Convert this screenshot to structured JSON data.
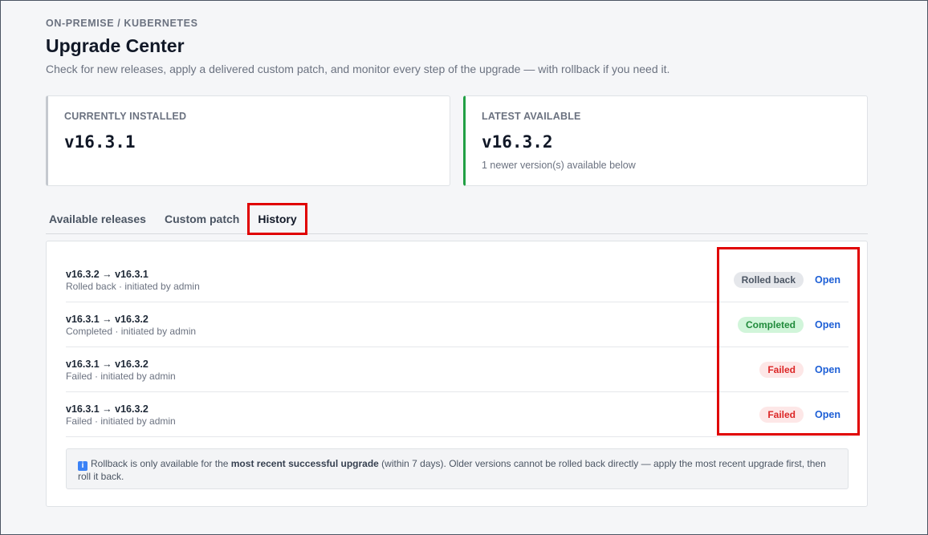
{
  "breadcrumb": "ON-PREMISE / KUBERNETES",
  "page": {
    "title": "Upgrade Center",
    "subtitle": "Check for new releases, apply a delivered custom patch, and monitor every step of the upgrade — with rollback if you need it."
  },
  "cards": {
    "installed": {
      "label": "CURRENTLY INSTALLED",
      "version": "v16.3.1"
    },
    "latest": {
      "label": "LATEST AVAILABLE",
      "version": "v16.3.2",
      "note": "1 newer version(s) available below"
    }
  },
  "tabs": [
    {
      "label": "Available releases"
    },
    {
      "label": "Custom patch"
    },
    {
      "label": "History",
      "active": true
    }
  ],
  "history": [
    {
      "title": "v16.3.2 → v16.3.1",
      "detail": "Rolled back · initiated by admin",
      "status": "Rolled back",
      "action": "Open"
    },
    {
      "title": "v16.3.1 → v16.3.2",
      "detail": "Completed · initiated by admin",
      "status": "Completed",
      "action": "Open"
    },
    {
      "title": "v16.3.1 → v16.3.2",
      "detail": "Failed · initiated by admin",
      "status": "Failed",
      "action": "Open"
    },
    {
      "title": "v16.3.1 → v16.3.2",
      "detail": "Failed · initiated by admin",
      "status": "Failed",
      "action": "Open"
    }
  ],
  "info": {
    "icon": "info-icon",
    "prefix": "Rollback is only available for the ",
    "bold": "most recent successful upgrade",
    "suffix": " (within 7 days). Older versions cannot be rolled back directly — apply the most recent upgrade first, then roll it back."
  },
  "colors": {
    "accent": "#1d5fd6",
    "success": "#1f8a3a",
    "danger": "#dc2626",
    "latest_border": "#22a045",
    "highlight": "#e00000"
  }
}
